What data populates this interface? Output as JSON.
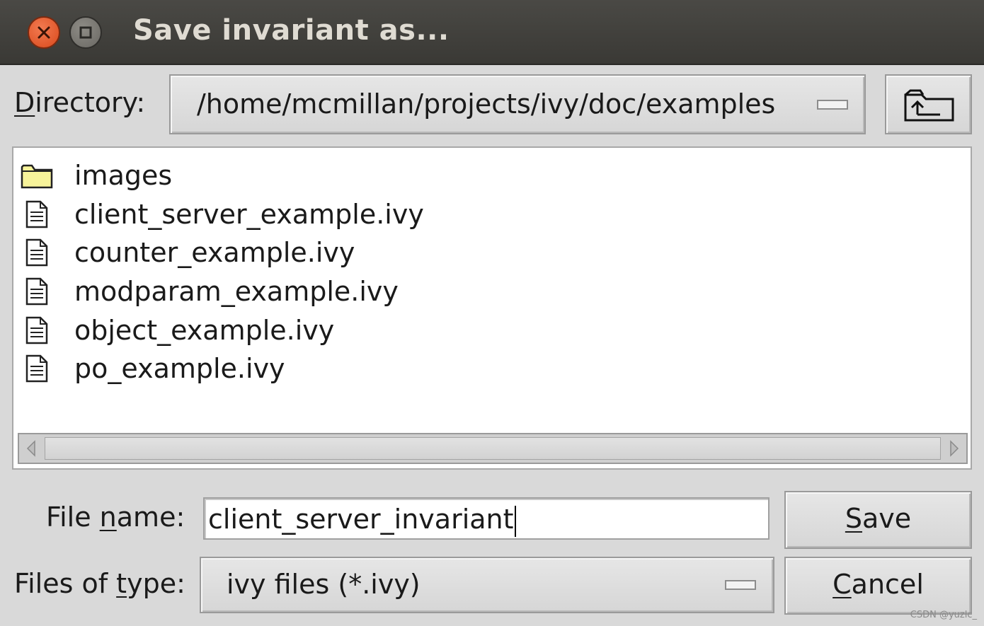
{
  "window": {
    "title": "Save invariant as..."
  },
  "directory": {
    "label_mnemonic": "D",
    "label_rest": "irectory:",
    "path": "/home/mcmillan/projects/ivy/doc/examples",
    "up_button_icon": "folder-up-icon"
  },
  "files": [
    {
      "name": "images",
      "type": "folder",
      "icon": "folder-icon"
    },
    {
      "name": "client_server_example.ivy",
      "type": "file",
      "icon": "document-icon"
    },
    {
      "name": "counter_example.ivy",
      "type": "file",
      "icon": "document-icon"
    },
    {
      "name": "modparam_example.ivy",
      "type": "file",
      "icon": "document-icon"
    },
    {
      "name": "object_example.ivy",
      "type": "file",
      "icon": "document-icon"
    },
    {
      "name": "po_example.ivy",
      "type": "file",
      "icon": "document-icon"
    }
  ],
  "filename": {
    "label_before": "File ",
    "label_mnemonic": "n",
    "label_after": "ame:",
    "value": "client_server_invariant"
  },
  "filetype": {
    "label_before": "Files of ",
    "label_mnemonic": "t",
    "label_after": "ype:",
    "value": "ivy files (*.ivy)"
  },
  "buttons": {
    "save_mnemonic": "S",
    "save_rest": "ave",
    "cancel_mnemonic": "C",
    "cancel_rest": "ancel"
  },
  "watermark": "CSDN @yuzlc_",
  "colors": {
    "titlebar": "#3f3e3a",
    "close_button": "#e8603a",
    "folder_fill": "#f7f39a",
    "dialog_bg": "#d9d9d9"
  }
}
